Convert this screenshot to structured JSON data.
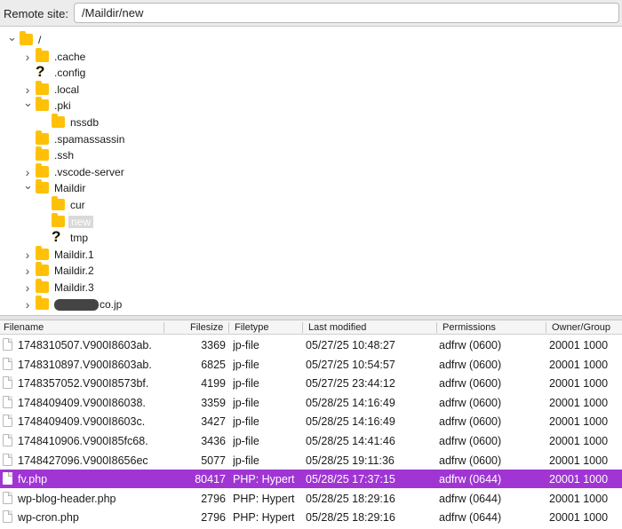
{
  "remote": {
    "label": "Remote site:",
    "path": "/Maildir/new"
  },
  "tree": [
    {
      "name": "/",
      "depth": 0,
      "chevron": "down",
      "icon": "folder"
    },
    {
      "name": ".cache",
      "depth": 1,
      "chevron": "right",
      "icon": "folder"
    },
    {
      "name": ".config",
      "depth": 1,
      "chevron": "none",
      "icon": "unknown"
    },
    {
      "name": ".local",
      "depth": 1,
      "chevron": "right",
      "icon": "folder"
    },
    {
      "name": ".pki",
      "depth": 1,
      "chevron": "down",
      "icon": "folder"
    },
    {
      "name": "nssdb",
      "depth": 2,
      "chevron": "none",
      "icon": "folder"
    },
    {
      "name": ".spamassassin",
      "depth": 1,
      "chevron": "none",
      "icon": "folder"
    },
    {
      "name": ".ssh",
      "depth": 1,
      "chevron": "none",
      "icon": "folder"
    },
    {
      "name": ".vscode-server",
      "depth": 1,
      "chevron": "right",
      "icon": "folder"
    },
    {
      "name": "Maildir",
      "depth": 1,
      "chevron": "down",
      "icon": "folder"
    },
    {
      "name": "cur",
      "depth": 2,
      "chevron": "none",
      "icon": "folder"
    },
    {
      "name": "new",
      "depth": 2,
      "chevron": "none",
      "icon": "folder",
      "selected": true
    },
    {
      "name": "tmp",
      "depth": 2,
      "chevron": "none",
      "icon": "unknown"
    },
    {
      "name": "Maildir.1",
      "depth": 1,
      "chevron": "right",
      "icon": "folder"
    },
    {
      "name": "Maildir.2",
      "depth": 1,
      "chevron": "right",
      "icon": "folder"
    },
    {
      "name": "Maildir.3",
      "depth": 1,
      "chevron": "right",
      "icon": "folder"
    },
    {
      "name": "co.jp",
      "depth": 1,
      "chevron": "right",
      "icon": "folder",
      "redacted": true
    }
  ],
  "columns": {
    "filename": "Filename",
    "filesize": "Filesize",
    "filetype": "Filetype",
    "modified": "Last modified",
    "permissions": "Permissions",
    "owner": "Owner/Group"
  },
  "files": [
    {
      "name": "1748310507.V900I8603ab.",
      "size": "3369",
      "type": "jp-file",
      "modified": "05/27/25 10:48:27",
      "perm": "adfrw (0600)",
      "owner": "20001 1000"
    },
    {
      "name": "1748310897.V900I8603ab.",
      "size": "6825",
      "type": "jp-file",
      "modified": "05/27/25 10:54:57",
      "perm": "adfrw (0600)",
      "owner": "20001 1000"
    },
    {
      "name": "1748357052.V900I8573bf.",
      "size": "4199",
      "type": "jp-file",
      "modified": "05/27/25 23:44:12",
      "perm": "adfrw (0600)",
      "owner": "20001 1000"
    },
    {
      "name": "1748409409.V900I86038.",
      "size": "3359",
      "type": "jp-file",
      "modified": "05/28/25 14:16:49",
      "perm": "adfrw (0600)",
      "owner": "20001 1000"
    },
    {
      "name": "1748409409.V900I8603c.",
      "size": "3427",
      "type": "jp-file",
      "modified": "05/28/25 14:16:49",
      "perm": "adfrw (0600)",
      "owner": "20001 1000"
    },
    {
      "name": "1748410906.V900I85fc68.",
      "size": "3436",
      "type": "jp-file",
      "modified": "05/28/25 14:41:46",
      "perm": "adfrw (0600)",
      "owner": "20001 1000"
    },
    {
      "name": "1748427096.V900I8656ec",
      "size": "5077",
      "type": "jp-file",
      "modified": "05/28/25 19:11:36",
      "perm": "adfrw (0600)",
      "owner": "20001 1000"
    },
    {
      "name": "fv.php",
      "size": "80417",
      "type": "PHP: Hypert",
      "modified": "05/28/25 17:37:15",
      "perm": "adfrw (0644)",
      "owner": "20001 1000",
      "selected": true
    },
    {
      "name": "wp-blog-header.php",
      "size": "2796",
      "type": "PHP: Hypert",
      "modified": "05/28/25 18:29:16",
      "perm": "adfrw (0644)",
      "owner": "20001 1000"
    },
    {
      "name": "wp-cron.php",
      "size": "2796",
      "type": "PHP: Hypert",
      "modified": "05/28/25 18:29:16",
      "perm": "adfrw (0644)",
      "owner": "20001 1000"
    }
  ],
  "colors": {
    "selection": "#a035d4",
    "folder": "#ffc107"
  }
}
